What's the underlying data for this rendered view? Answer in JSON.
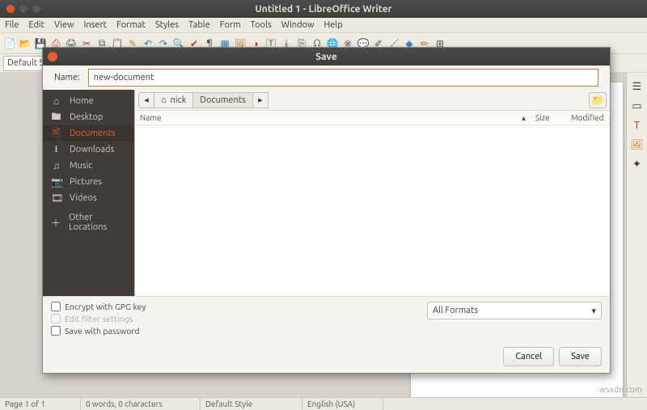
{
  "window": {
    "title": "Untitled 1 - LibreOffice Writer"
  },
  "menu": {
    "items": [
      "File",
      "Edit",
      "View",
      "Insert",
      "Format",
      "Styles",
      "Table",
      "Form",
      "Tools",
      "Window",
      "Help"
    ]
  },
  "stylebar": {
    "style": "Default S"
  },
  "dialog": {
    "title": "Save",
    "name_label": "Name:",
    "name_value": "new-document",
    "places": [
      {
        "icon": "⌂",
        "label": "Home"
      },
      {
        "icon": "🖿",
        "label": "Desktop"
      },
      {
        "icon": "🖹",
        "label": "Documents",
        "active": true
      },
      {
        "icon": "⭳",
        "label": "Downloads"
      },
      {
        "icon": "♫",
        "label": "Music"
      },
      {
        "icon": "📷",
        "label": "Pictures"
      },
      {
        "icon": "🎞",
        "label": "Videos"
      },
      {
        "icon": "＋",
        "label": "Other Locations",
        "sep": true
      }
    ],
    "path": {
      "back": "◂",
      "home_icon": "⌂",
      "user": "nick",
      "current": "Documents",
      "forward": "▸"
    },
    "columns": {
      "name": "Name",
      "size": "Size",
      "modified": "Modified"
    },
    "checks": {
      "gpg": "Encrypt with GPG key",
      "filter": "Edit filter settings",
      "password": "Save with password"
    },
    "format": "All Formats",
    "cancel": "Cancel",
    "save": "Save"
  },
  "statusbar": {
    "page": "Page 1 of 1",
    "words": "0 words, 0 characters",
    "style": "Default Style",
    "lang": "English (USA)"
  },
  "watermark": "wsxdn.com"
}
